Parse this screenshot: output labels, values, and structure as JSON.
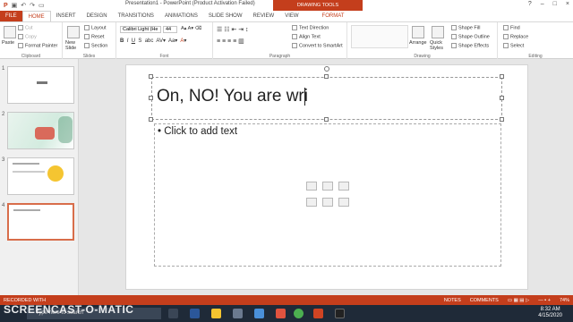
{
  "window": {
    "title": "Presentation1 - PowerPoint (Product Activation Failed)",
    "context_tab": "DRAWING TOOLS",
    "buttons": [
      "?",
      "–",
      "□",
      "×"
    ]
  },
  "tabs": [
    "FILE",
    "HOME",
    "INSERT",
    "DESIGN",
    "TRANSITIONS",
    "ANIMATIONS",
    "SLIDE SHOW",
    "REVIEW",
    "VIEW",
    "FORMAT"
  ],
  "ribbon": {
    "clipboard": {
      "label": "Clipboard",
      "paste": "Paste",
      "cut": "Cut",
      "copy": "Copy",
      "format_painter": "Format Painter"
    },
    "slides": {
      "label": "Slides",
      "new_slide": "New Slide",
      "layout": "Layout",
      "reset": "Reset",
      "section": "Section"
    },
    "font": {
      "label": "Font",
      "font_name": "Calibri Light (He",
      "font_size": "44"
    },
    "paragraph": {
      "label": "Paragraph",
      "text_direction": "Text Direction",
      "align_text": "Align Text",
      "convert_smartart": "Convert to SmartArt"
    },
    "drawing": {
      "label": "Drawing",
      "arrange": "Arrange",
      "quick_styles": "Quick Styles",
      "shape_fill": "Shape Fill",
      "shape_outline": "Shape Outline",
      "shape_effects": "Shape Effects"
    },
    "editing": {
      "label": "Editing",
      "find": "Find",
      "replace": "Replace",
      "select": "Select"
    }
  },
  "thumbnails": [
    {
      "num": "1",
      "text": ""
    },
    {
      "num": "2",
      "text": ""
    },
    {
      "num": "3",
      "text": ""
    },
    {
      "num": "4",
      "text": ""
    }
  ],
  "slide": {
    "title": "On, NO! You are wri",
    "content": "• Click to add text"
  },
  "status": {
    "recorded": "RECORDED WITH",
    "notes": "NOTES",
    "comments": "COMMENTS",
    "zoom": "74%"
  },
  "taskbar": {
    "watermark": "SCREENCAST-O-MATIC",
    "search": "Type here to search",
    "time": "8:32 AM",
    "date": "4/15/2020"
  }
}
